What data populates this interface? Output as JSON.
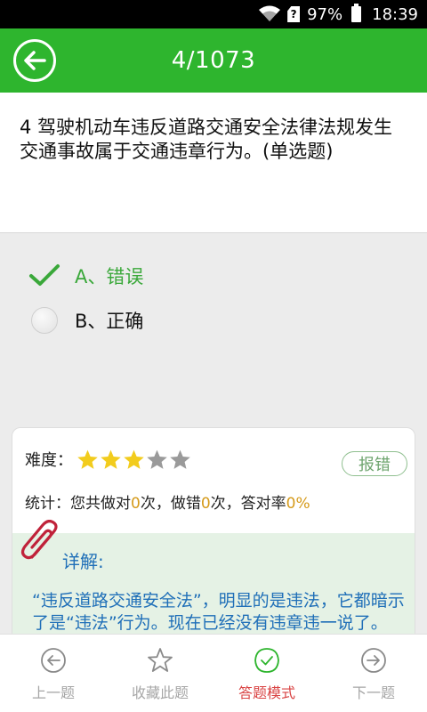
{
  "status_bar": {
    "sim_label": "?",
    "battery_percent": "97%",
    "time": "18:39"
  },
  "header": {
    "progress": "4/1073"
  },
  "question": {
    "text": "4  驾驶机动车违反道路交通安全法律法规发生交通事故属于交通违章行为。(单选题)"
  },
  "options": [
    {
      "label": "A、错误",
      "selected": true
    },
    {
      "label": "B、正确",
      "selected": false
    }
  ],
  "card": {
    "difficulty_label": "难度：",
    "difficulty_stars": 3,
    "difficulty_max": 5,
    "report_button": "报错",
    "stats": {
      "prefix": "统计：您共做对",
      "correct": "0",
      "mid1": "次，做错",
      "wrong": "0",
      "mid2": "次，答对率",
      "rate": "0%"
    },
    "detail_title": "详解:",
    "detail_text": "“违反道路交通安全法”，明显的是违法，它都暗示了是“违法”行为。现在已经没有违章违一说了。"
  },
  "bottom_nav": [
    {
      "label": "上一题",
      "icon": "arrow-left-circle-icon"
    },
    {
      "label": "收藏此题",
      "icon": "star-outline-icon"
    },
    {
      "label": "答题模式",
      "icon": "check-circle-icon",
      "active": true
    },
    {
      "label": "下一题",
      "icon": "arrow-right-circle-icon"
    }
  ],
  "colors": {
    "header_green": "#2eb52e",
    "selected_green": "#3aa83a",
    "star_yellow": "#f2cc1d",
    "star_gray": "#9a9a9a",
    "stat_number": "#d59a1a",
    "detail_blue": "#1f6fb8",
    "active_nav": "#d94343"
  }
}
